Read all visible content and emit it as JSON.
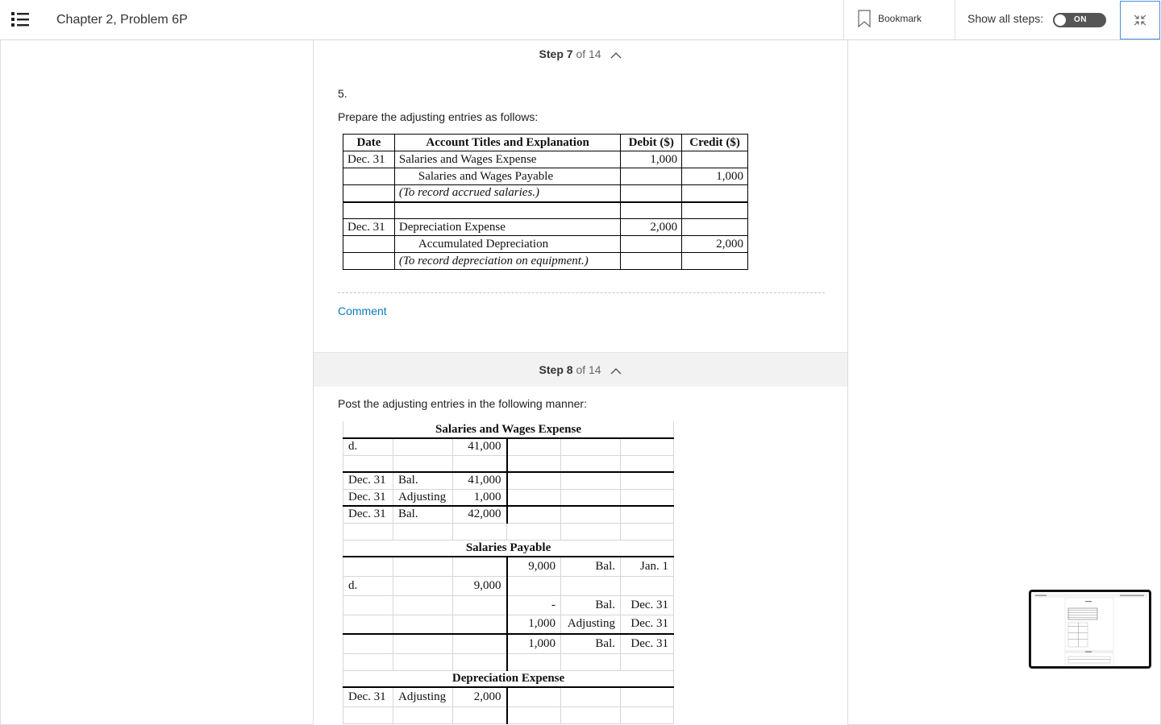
{
  "header": {
    "title": "Chapter 2, Problem 6P",
    "bookmark_label": "Bookmark",
    "show_all_steps_label": "Show all steps:",
    "toggle_state": "ON",
    "menu_icon": "list-icon",
    "collapse_icon": "collapse-icon"
  },
  "step7": {
    "label": "Step 7",
    "of": "of 14",
    "number": "5.",
    "intro": "Prepare the adjusting entries as follows:",
    "table": {
      "headers": [
        "Date",
        "Account Titles and Explanation",
        "Debit ($)",
        "Credit ($)"
      ],
      "rows": [
        {
          "date": "Dec. 31",
          "account": "Salaries and Wages Expense",
          "debit": "1,000",
          "credit": ""
        },
        {
          "date": "",
          "account": "Salaries and Wages Payable",
          "debit": "",
          "credit": "1,000"
        },
        {
          "date": "",
          "account": "(To record accrued salaries.)",
          "debit": "",
          "credit": ""
        },
        {
          "date": "",
          "account": "",
          "debit": "",
          "credit": ""
        },
        {
          "date": "Dec. 31",
          "account": "Depreciation Expense",
          "debit": "2,000",
          "credit": ""
        },
        {
          "date": "",
          "account": "Accumulated Depreciation",
          "debit": "",
          "credit": "2,000"
        },
        {
          "date": "",
          "account": "(To record depreciation on equipment.)",
          "debit": "",
          "credit": ""
        }
      ]
    },
    "comment_label": "Comment"
  },
  "step8": {
    "label": "Step 8",
    "of": "of 14",
    "intro": "Post the adjusting entries in the following manner:",
    "accounts": {
      "salaries_wages_expense": {
        "title": "Salaries and Wages Expense",
        "rows": [
          [
            "d.",
            "",
            "41,000",
            "",
            "",
            ""
          ],
          [
            "",
            "",
            "",
            "",
            "",
            ""
          ],
          [
            "Dec. 31",
            "Bal.",
            "41,000",
            "",
            "",
            ""
          ],
          [
            "Dec. 31",
            "Adjusting",
            "1,000",
            "",
            "",
            ""
          ],
          [
            "Dec. 31",
            "Bal.",
            "42,000",
            "",
            "",
            ""
          ],
          [
            "",
            "",
            "",
            "",
            "",
            ""
          ]
        ]
      },
      "salaries_payable": {
        "title": "Salaries Payable",
        "rows": [
          [
            "",
            "",
            "",
            "9,000",
            "Bal.",
            "Jan. 1"
          ],
          [
            "d.",
            "",
            "9,000",
            "",
            "",
            ""
          ],
          [
            "",
            "",
            "",
            "-",
            "Bal.",
            "Dec. 31"
          ],
          [
            "",
            "",
            "",
            "1,000",
            "Adjusting",
            "Dec. 31"
          ],
          [
            "",
            "",
            "",
            "1,000",
            "Bal.",
            "Dec. 31"
          ],
          [
            "",
            "",
            "",
            "",
            "",
            ""
          ]
        ]
      },
      "depreciation_expense": {
        "title": "Depreciation Expense",
        "rows": [
          [
            "Dec. 31",
            "Adjusting",
            "2,000",
            "",
            "",
            ""
          ],
          [
            "",
            "",
            "",
            "",
            "",
            ""
          ]
        ]
      }
    }
  }
}
